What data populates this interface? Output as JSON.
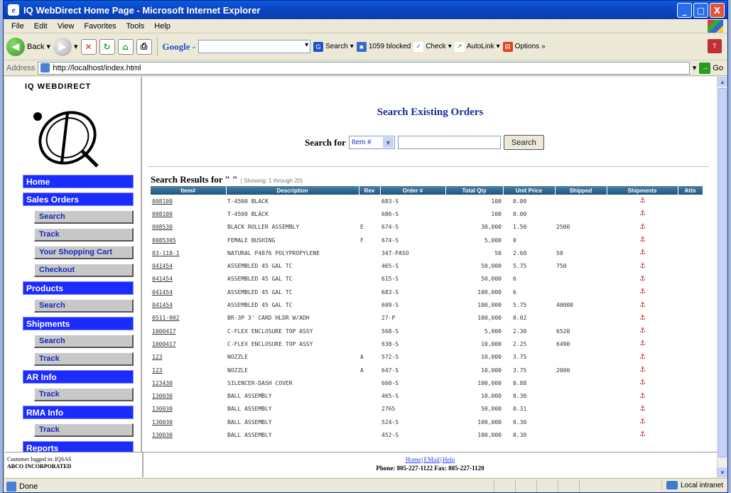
{
  "window": {
    "title": "IQ WebDirect Home Page - Microsoft Internet Explorer",
    "controls": [
      "_",
      "□",
      "X"
    ]
  },
  "menu": [
    "File",
    "Edit",
    "View",
    "Favorites",
    "Tools",
    "Help"
  ],
  "toolbar": {
    "back": "Back",
    "google": "Google -",
    "search": "Search",
    "blocked": "1059 blocked",
    "check": "Check",
    "autolink": "AutoLink",
    "options": "Options",
    "more": "»"
  },
  "address": {
    "label": "Address",
    "url": "http://localhost/index.html",
    "go": "Go"
  },
  "logo": {
    "text": "IQ WEBDIRECT"
  },
  "nav": [
    {
      "label": "Home",
      "level": "main"
    },
    {
      "label": "Sales Orders",
      "level": "main"
    },
    {
      "label": "Search",
      "level": "sub"
    },
    {
      "label": "Track",
      "level": "sub"
    },
    {
      "label": "Your Shopping Cart",
      "level": "sub"
    },
    {
      "label": "Checkout",
      "level": "sub"
    },
    {
      "label": "Products",
      "level": "main"
    },
    {
      "label": "Search",
      "level": "sub"
    },
    {
      "label": "Shipments",
      "level": "main"
    },
    {
      "label": "Search",
      "level": "sub"
    },
    {
      "label": "Track",
      "level": "sub"
    },
    {
      "label": "AR Info",
      "level": "main"
    },
    {
      "label": "Track",
      "level": "sub"
    },
    {
      "label": "RMA Info",
      "level": "main"
    },
    {
      "label": "Track",
      "level": "sub"
    },
    {
      "label": "Reports",
      "level": "main"
    }
  ],
  "main": {
    "title": "Search Existing Orders",
    "search_for_label": "Search for",
    "search_field_value": "Item #",
    "search_input_value": "",
    "search_button": "Search",
    "results_title": "Search Results for \" \"",
    "results_showing": "( Showing: 1 through 20)"
  },
  "results": {
    "columns": [
      "Item#",
      "Description",
      "Rev",
      "Order #",
      "Total Qty",
      "Unit Price",
      "Shipped",
      "Shipments",
      "Attn"
    ],
    "rows": [
      {
        "item": "008100",
        "desc": "T-4500 BLACK",
        "rev": "",
        "order": "683-S",
        "qty": "100",
        "price": "0.00",
        "shipped": ""
      },
      {
        "item": "008100",
        "desc": "T-4500 BLACK",
        "rev": "",
        "order": "686-S",
        "qty": "100",
        "price": "0.00",
        "shipped": ""
      },
      {
        "item": "008530",
        "desc": "BLACK ROLLER ASSEMBLY",
        "rev": "E",
        "order": "674-S",
        "qty": "30,000",
        "price": "1.50",
        "shipped": "2500"
      },
      {
        "item": "0085305",
        "desc": "FEMALE BUSHING",
        "rev": "F",
        "order": "674-S",
        "qty": "5,000",
        "price": "0",
        "shipped": ""
      },
      {
        "item": "03-118-1",
        "desc": "NATURAL P4076 POLYPROPYLENE",
        "rev": "",
        "order": "347-PASO",
        "qty": "50",
        "price": "2.60",
        "shipped": "50"
      },
      {
        "item": "041454",
        "desc": "ASSEMBLED 45 GAL TC",
        "rev": "",
        "order": "465-S",
        "qty": "50,000",
        "price": "5.75",
        "shipped": "750"
      },
      {
        "item": "041454",
        "desc": "ASSEMBLED 45 GAL TC",
        "rev": "",
        "order": "615-S",
        "qty": "50,000",
        "price": "6",
        "shipped": ""
      },
      {
        "item": "041454",
        "desc": "ASSEMBLED 45 GAL TC",
        "rev": "",
        "order": "683-S",
        "qty": "100,000",
        "price": "6",
        "shipped": ""
      },
      {
        "item": "041454",
        "desc": "ASSEMBLED 45 GAL TC",
        "rev": "",
        "order": "609-S",
        "qty": "100,000",
        "price": "5.75",
        "shipped": "40000"
      },
      {
        "item": "0511-002",
        "desc": "BR-3P 3' CARD HLDR W/ADH",
        "rev": "",
        "order": "27-P",
        "qty": "100,000",
        "price": "0.02",
        "shipped": ""
      },
      {
        "item": "1000417",
        "desc": "C-FLEX ENCLOSURE TOP ASSY",
        "rev": "",
        "order": "568-S",
        "qty": "5,000",
        "price": "2.30",
        "shipped": "6520"
      },
      {
        "item": "1000417",
        "desc": "C-FLEX ENCLOSURE TOP ASSY",
        "rev": "",
        "order": "638-S",
        "qty": "10,000",
        "price": "2.25",
        "shipped": "6490"
      },
      {
        "item": "123",
        "desc": "NOZZLE",
        "rev": "A",
        "order": "572-S",
        "qty": "10,000",
        "price": "3.75",
        "shipped": ""
      },
      {
        "item": "123",
        "desc": "NOZZLE",
        "rev": "A",
        "order": "647-S",
        "qty": "10,000",
        "price": "3.75",
        "shipped": "2000"
      },
      {
        "item": "123430",
        "desc": "SILENCER-DASH COVER",
        "rev": "",
        "order": "660-S",
        "qty": "100,000",
        "price": "0.88",
        "shipped": ""
      },
      {
        "item": "130030",
        "desc": "BALL ASSEMBLY",
        "rev": "",
        "order": "465-S",
        "qty": "10,000",
        "price": "0.30",
        "shipped": ""
      },
      {
        "item": "130030",
        "desc": "BALL ASSEMBLY",
        "rev": "",
        "order": "2765",
        "qty": "50,000",
        "price": "0.31",
        "shipped": ""
      },
      {
        "item": "130030",
        "desc": "BALL ASSEMBLY",
        "rev": "",
        "order": "524-S",
        "qty": "100,000",
        "price": "0.30",
        "shipped": ""
      },
      {
        "item": "130030",
        "desc": "BALL ASSEMBLY",
        "rev": "",
        "order": "452-S",
        "qty": "100,000",
        "price": "0.30",
        "shipped": ""
      }
    ]
  },
  "footer": {
    "logged_in": "Customer logged in: IQSAS",
    "company": "ABCO INCORPORATED",
    "links": [
      "Home",
      "EMail",
      "Help"
    ],
    "phone": "Phone: 805-227-1122 Fax: 805-227-1120"
  },
  "status": {
    "text": "Done",
    "zone": "Local intranet"
  }
}
